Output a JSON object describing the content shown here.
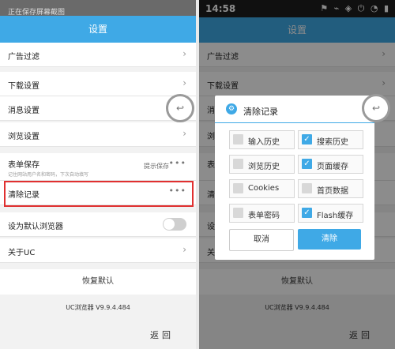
{
  "left": {
    "status": {
      "notice": "正在保存屏幕截图"
    },
    "header": {
      "title": "设置"
    },
    "items": {
      "ad_filter": "广告过滤",
      "download": "下载设置",
      "message": "消息设置",
      "browse": "浏览设置",
      "form_save": "表单保存",
      "form_save_sub": "记住网站用户名和密码，下次自动填写",
      "form_save_value": "提示保存",
      "clear_records": "清除记录",
      "default_browser": "设为默认浏览器",
      "about": "关于UC"
    },
    "restore": "恢复默认",
    "version": "UC浏览器 V9.9.4.484",
    "back": "返回"
  },
  "right": {
    "status": {
      "time": "14:58"
    },
    "header": {
      "title": "设置"
    },
    "items": {
      "ad_filter": "广告过滤",
      "download": "下载设置",
      "message_partial": "消",
      "browse_partial": "浏",
      "form_partial": "表",
      "clear_partial": "清",
      "default_partial": "设",
      "about_partial": "关"
    },
    "restore": "恢复默认",
    "version": "UC浏览器 V9.9.4.484",
    "back": "返回",
    "dialog": {
      "title": "清除记录",
      "options": [
        {
          "label": "输入历史",
          "checked": false
        },
        {
          "label": "搜索历史",
          "checked": true
        },
        {
          "label": "浏览历史",
          "checked": false
        },
        {
          "label": "页面缓存",
          "checked": true
        },
        {
          "label": "Cookies",
          "checked": false
        },
        {
          "label": "首页数据",
          "checked": false
        },
        {
          "label": "表单密码",
          "checked": false
        },
        {
          "label": "Flash缓存",
          "checked": true
        }
      ],
      "cancel": "取消",
      "confirm": "清除"
    }
  },
  "colors": {
    "accent": "#3fa9e6",
    "highlight": "#e03030"
  }
}
